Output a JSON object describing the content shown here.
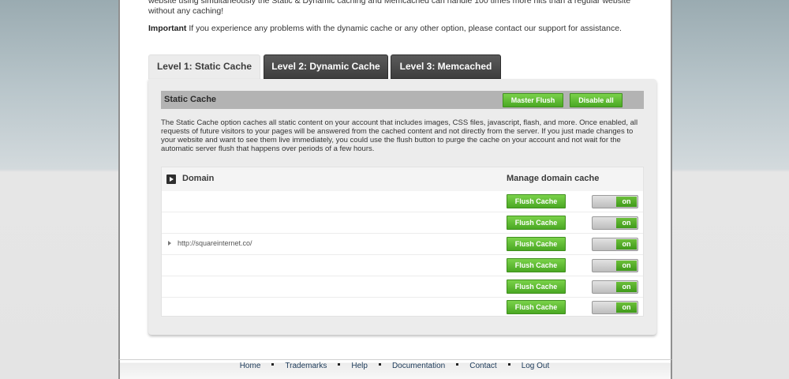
{
  "intro": {
    "text": "website using simultaneously the Static & Dynamic caching and Memcached can handle 100 times more hits than a regular website without any caching!",
    "important_label": "Important",
    "important_text": " If you experience any problems with the dynamic cache or any other option, please contact our support for assistance."
  },
  "tabs": [
    {
      "label": "Level 1: Static Cache",
      "active": true
    },
    {
      "label": "Level 2: Dynamic Cache",
      "active": false
    },
    {
      "label": "Level 3: Memcached",
      "active": false
    }
  ],
  "panel": {
    "title": "Static Cache",
    "master_flush_label": "Master Flush",
    "disable_all_label": "Disable all",
    "description": "The Static Cache option caches all static content on your account that includes images, CSS files, javascript, flash, and more. Once enabled, all requests of future visitors to your pages will be answered from the cached content and not directly from the server. If you just made changes to your website and want to see them live immediately, you could use the flush button to purge the cache on your account and not wait for the automatic server flush that happens over periods of a few hours."
  },
  "table": {
    "col_domain": "Domain",
    "col_manage": "Manage domain cache",
    "domain": "http://squareinternet.co/",
    "rows": [
      {
        "flush_label": "Flush Cache",
        "toggle": "on"
      },
      {
        "flush_label": "Flush Cache",
        "toggle": "on"
      },
      {
        "flush_label": "Flush Cache",
        "toggle": "on"
      },
      {
        "flush_label": "Flush Cache",
        "toggle": "on"
      },
      {
        "flush_label": "Flush Cache",
        "toggle": "on"
      },
      {
        "flush_label": "Flush Cache",
        "toggle": "on"
      }
    ]
  },
  "footer": {
    "links": [
      "Home",
      "Trademarks",
      "Help",
      "Documentation",
      "Contact",
      "Log Out"
    ]
  }
}
